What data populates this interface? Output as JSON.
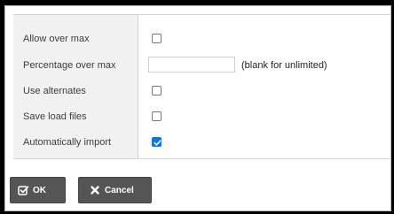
{
  "form": {
    "rows": [
      {
        "label": "Allow over max",
        "checked": false
      },
      {
        "label": "Percentage over max",
        "value": "",
        "hint": "(blank for unlimited)"
      },
      {
        "label": "Use alternates",
        "checked": false
      },
      {
        "label": "Save load files",
        "checked": false
      },
      {
        "label": "Automatically import",
        "checked": true
      }
    ]
  },
  "buttons": {
    "ok": {
      "label": "OK",
      "icon": "check-square-icon"
    },
    "cancel": {
      "label": "Cancel",
      "icon": "x-icon"
    }
  },
  "colors": {
    "checkbox_checked": "#0075ff",
    "button_bg": "#555555",
    "label_column_bg": "#f1f1f1"
  }
}
